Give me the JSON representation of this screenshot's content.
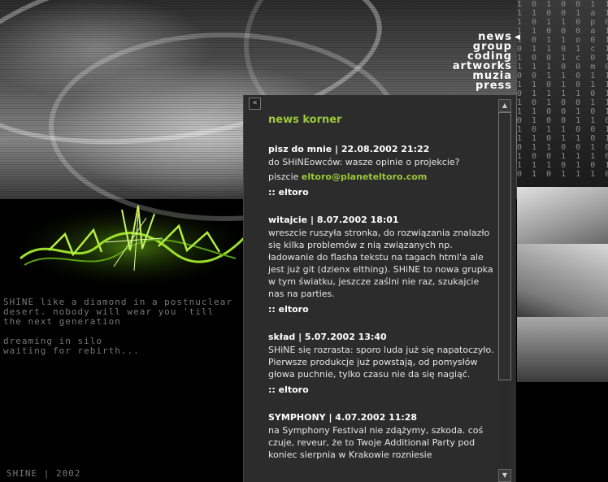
{
  "nav": {
    "items": [
      {
        "label": "news"
      },
      {
        "label": "group"
      },
      {
        "label": "coding"
      },
      {
        "label": "artworks"
      },
      {
        "label": "muzia"
      },
      {
        "label": "press"
      }
    ]
  },
  "matrix_text": "1 0 1 0 0 1 1 0 1\n1 1 0 0 1 a 1 1 0\n1 0 1 1 0 p 0 0 1\n1 1 0 0 0 a 1 0 1\n1 0 1 1 o 0 1 1 0\n0 1 1 0 1 c 1 0 0\n1 0 0 1 c 0 1 1 1\n1 1 1 0 0 m 0 0 1\n0 0 1 1 0 1 1 1 0\n1 1 0 1 0 1 1 0 1\n0 1 1 1 1 0 1 0 1\n1 0 1 0 0 1 1 0 0\n1 1 0 0 1 0 1 1 1\n0 1 0 0 1 1 0 1 1\n1 0 1 1 0 0 1 0 0\n1 1 0 1 1 0 1 1 0\n0 1 1 0 0 1 0 1 1\n1 0 0 1 1 1 0 0 1\n1 1 1 0 1 0 1 1 0\n0 1 0 1 1 1 0 0 1",
  "tagline": {
    "line1": "SHINE like a diamond in a postnuclear",
    "line2": "desert. nobody will wear you 'till",
    "line3": "the next generation",
    "line4": "dreaming in silo",
    "line5": "waiting for rebirth..."
  },
  "footer": {
    "text": "SHINE | 2002"
  },
  "panel": {
    "collapse_label": "«",
    "scroll_up": "▲",
    "scroll_down": "▼"
  },
  "news": {
    "title": "news korner",
    "entries": [
      {
        "head": "pisz do mnie | 22.08.2002 21:22",
        "line1": "do SHiNEowców: wasze opinie o projekcie?",
        "line2_prefix": "piszcie ",
        "email": "eltoro@planeteltoro.com",
        "sig": ":: eltoro"
      },
      {
        "head": "witajcie | 8.07.2002 18:01",
        "body": "wreszcie ruszyła stronka, do rozwiązania znalazło się kilka problemów z nią związanych np. ładowanie do flasha tekstu na tagach html'a ale jest już git (dzienx elthing). SHiNE to nowa grupka w tym światku, jeszcze zaślni nie raz, szukajcie nas na parties.",
        "sig": ":: eltoro"
      },
      {
        "head": "skład | 5.07.2002 13:40",
        "body": "SHiNE się rozrasta: sporo luda już się napatoczyło. Pierwsze produkcje już powstają, od pomysłów głowa puchnie, tylko czasu nie da  się nagiąć.",
        "sig": ":: eltoro"
      },
      {
        "head": "SYMPHONY | 4.07.2002 11:28",
        "body": "na Symphony Festival nie zdążymy, szkoda. coś czuje, reveur, że to Twoje Additional Party pod koniec sierpnia w Krakowie rozniesie"
      }
    ]
  }
}
